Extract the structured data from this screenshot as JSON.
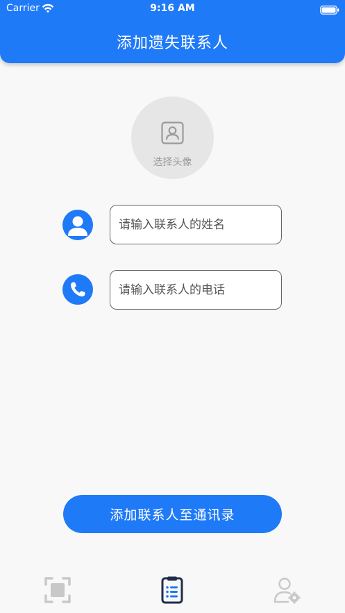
{
  "status_bar": {
    "carrier": "Carrier",
    "time": "9:16 AM"
  },
  "header": {
    "title": "添加遗失联系人"
  },
  "avatar": {
    "label": "选择头像"
  },
  "form": {
    "name_placeholder": "请输入联系人的姓名",
    "name_value": "",
    "phone_placeholder": "请输入联系人的电话",
    "phone_value": ""
  },
  "submit": {
    "label": "添加联系人至通讯录"
  },
  "tabs": [
    {
      "icon": "scan-icon",
      "active": false
    },
    {
      "icon": "clipboard-list-icon",
      "active": true
    },
    {
      "icon": "user-settings-icon",
      "active": false
    }
  ],
  "colors": {
    "primary": "#1f7af8",
    "background": "#f8f8f8",
    "inactive_icon": "#c8c8c8",
    "active_icon": "#1f2d4a"
  }
}
